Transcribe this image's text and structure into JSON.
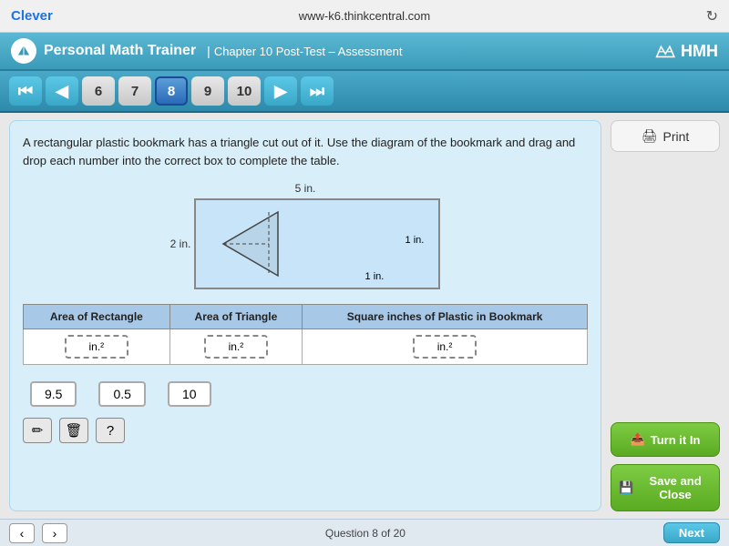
{
  "browser": {
    "clever_label": "Clever",
    "url": "www-k6.thinkcentral.com",
    "refresh_icon": "↻"
  },
  "header": {
    "logo_icon": "★",
    "trainer_title": "Personal Math Trainer",
    "chapter_title": "Chapter 10 Post-Test – Assessment",
    "hmh_label": "HMH"
  },
  "navigation": {
    "first_btn": "⏮",
    "prev_btn": "◀",
    "numbers": [
      "6",
      "7",
      "8",
      "9",
      "10"
    ],
    "active_number": "8",
    "next_btn": "▶",
    "last_btn": "⏭"
  },
  "question": {
    "text": "A rectangular plastic bookmark has a triangle cut out of it. Use the diagram of the bookmark and drag and drop each number into the correct box to complete the table.",
    "diagram": {
      "label_top": "5 in.",
      "label_left": "2 in.",
      "label_triangle_1": "1 in.",
      "label_triangle_2": "1 in."
    },
    "table": {
      "headers": [
        "Area of Rectangle",
        "Area of Triangle",
        "Square inches of Plastic in Bookmark"
      ],
      "row": {
        "col1_unit": "in.²",
        "col2_unit": "in.²",
        "col3_unit": "in.²"
      }
    },
    "draggable_numbers": [
      "9.5",
      "0.5",
      "10"
    ],
    "tools": {
      "pencil": "✏",
      "trash": "🗑",
      "help": "?"
    }
  },
  "sidebar": {
    "print_label": "Print",
    "print_icon": "🖨",
    "turn_in_label": "Turn it In",
    "turn_in_icon": "📤",
    "save_close_label": "Save and Close",
    "save_close_icon": "💾"
  },
  "bottom": {
    "prev_icon": "‹",
    "next_icon": "›",
    "counter": "Question 8 of 20",
    "next_label": "Next"
  }
}
